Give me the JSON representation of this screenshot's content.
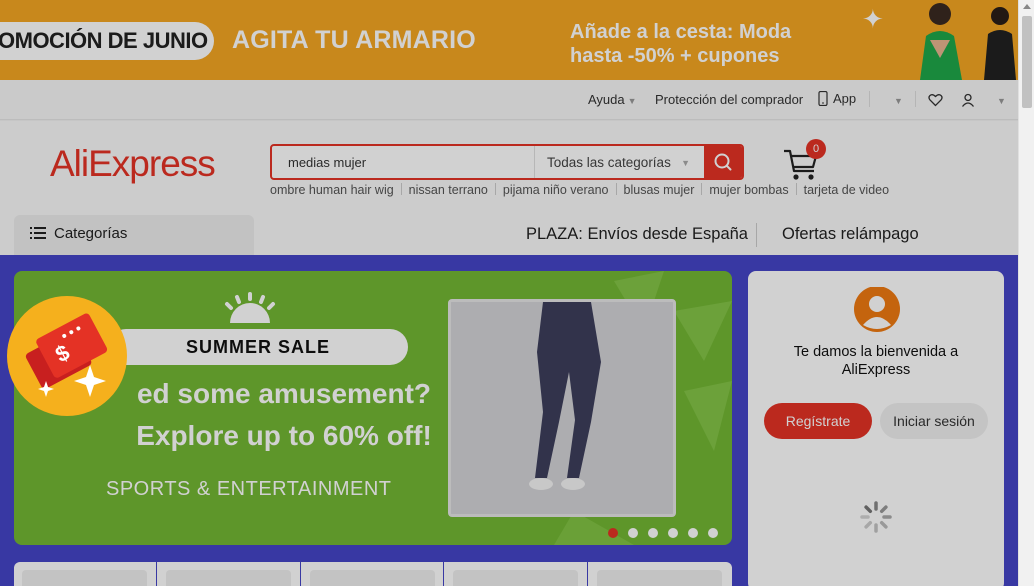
{
  "promo": {
    "pill_text": "OMOCIÓN DE JUNIO",
    "slogan": "AGITA TU ARMARIO",
    "right_line1": "Añade a la cesta: Moda",
    "right_line2": "hasta -50% + cupones"
  },
  "topbar": {
    "help": "Ayuda",
    "buyer_protection": "Protección del comprador",
    "app": "App"
  },
  "header": {
    "logo": "AliExpress",
    "search_value": "medias mujer",
    "search_category": "Todas las categorías",
    "cart_count": "0",
    "suggestions": [
      "ombre human hair wig",
      "nissan terrano",
      "pijama niño verano",
      "blusas mujer",
      "mujer bombas",
      "tarjeta de video"
    ],
    "categories_label": "Categorías",
    "nav_plaza": "PLAZA: Envíos desde España",
    "nav_flash": "Ofertas relámpago"
  },
  "hero": {
    "badge": "SUMMER SALE",
    "headline_line1": "ed some amusement?",
    "headline_line2": "Explore up to 60% off!",
    "subline": "SPORTS & ENTERTAINMENT",
    "slide_count": 6,
    "active_slide": 1
  },
  "welcome": {
    "line1": "Te damos la bienvenida a",
    "line2": "AliExpress",
    "register": "Regístrate",
    "login": "Iniciar sesión"
  },
  "colors": {
    "brand": "#e43225",
    "promo_bg": "#f5a623",
    "main_bg": "#4545c7",
    "hero_bg": "#73b834",
    "avatar": "#f07a12"
  }
}
